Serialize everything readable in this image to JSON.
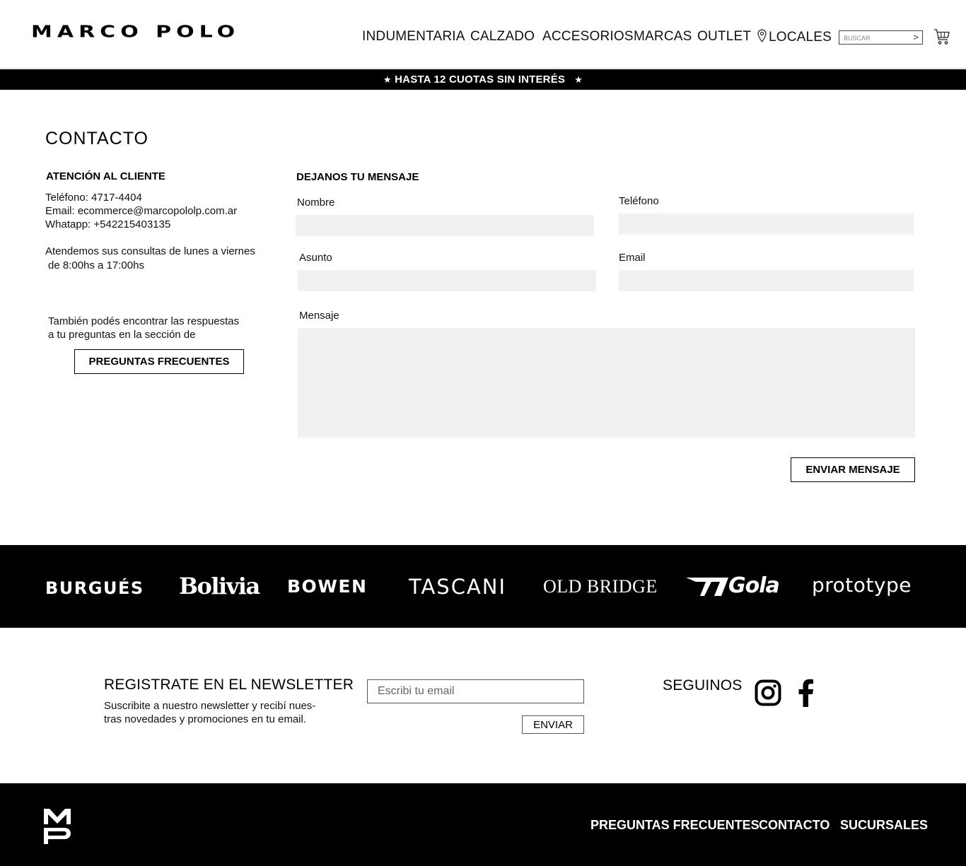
{
  "header": {
    "logo": "MARCO POLO",
    "nav": [
      "INDUMENTARIA",
      "CALZADO",
      "ACCESORIOS",
      "MARCAS",
      "OUTLET",
      "LOCALES"
    ],
    "search_placeholder": "BUSCAR",
    "search_submit": ">",
    "icons": {
      "locales": "map-pin-icon",
      "cart": "cart-icon"
    }
  },
  "promo": {
    "star": "★",
    "text": "HASTA 12 CUOTAS SIN INTERÉS"
  },
  "contact": {
    "title": "CONTACTO",
    "customer_service": {
      "title": "ATENCIÓN AL CLIENTE",
      "phone": "Teléfono: 4717-4404",
      "email": "Email: ecommerce@marcopololp.com.ar",
      "whatsapp": "Whatapp: +542215403135",
      "hours_line1": "Atendemos sus consultas de lunes a viernes",
      "hours_line2": "de 8:00hs a 17:00hs",
      "faq_line1": "También podés encontrar las respuestas",
      "faq_line2": "a tu preguntas en la sección de",
      "faq_button": "PREGUNTAS FRECUENTES"
    },
    "form": {
      "title": "DEJANOS TU MENSAJE",
      "name_label": "Nombre",
      "phone_label": "Teléfono",
      "subject_label": "Asunto",
      "email_label": "Email",
      "message_label": "Mensaje",
      "submit": "ENVIAR MENSAJE"
    }
  },
  "brands": [
    "BURGUÉS",
    "Bolivia",
    "BOWEN",
    "TASCANI",
    "OLD BRIDGE",
    "Gola",
    "prototype"
  ],
  "newsletter": {
    "title": "REGISTRATE EN EL NEWSLETTER",
    "description": "Suscribite a nuestro newsletter y recibí nuevas novedades y promociones en tu email.",
    "desc_line1": "Suscribite a nuestro newsletter y recibí nues-",
    "desc_line2": "tras novedades y promociones en tu email.",
    "email_placeholder": "Escribi tu email",
    "submit": "ENVIAR"
  },
  "social": {
    "title": "SEGUINOS",
    "icons": [
      "instagram-icon",
      "facebook-icon"
    ]
  },
  "footer": {
    "logo": "MP",
    "links": [
      "PREGUNTAS FRECUENTES",
      "CONTACTO",
      "SUCURSALES"
    ]
  },
  "colors": {
    "text": "#000000",
    "field_bg": "#f1f1f1",
    "dark_band": "#000000",
    "background": "#ffffff"
  }
}
